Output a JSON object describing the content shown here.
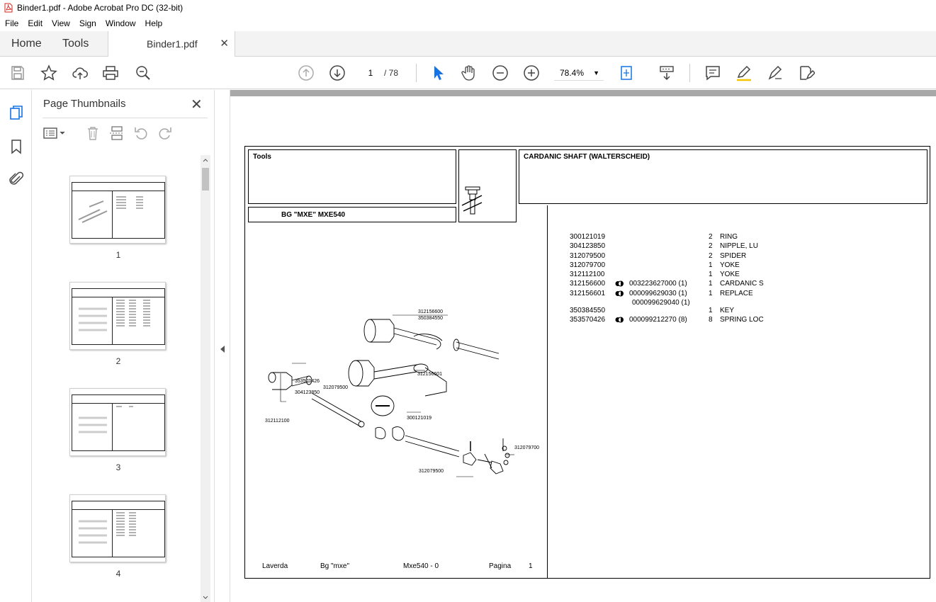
{
  "window": {
    "title": "Binder1.pdf - Adobe Acrobat Pro DC (32-bit)"
  },
  "menu": [
    "File",
    "Edit",
    "View",
    "Sign",
    "Window",
    "Help"
  ],
  "tabs": {
    "home": "Home",
    "tools": "Tools",
    "doc": "Binder1.pdf"
  },
  "toolbar": {
    "page_current": "1",
    "page_total": "/  78",
    "zoom": "78.4%"
  },
  "side_panel": {
    "title": "Page Thumbnails",
    "thumbnails": [
      "1",
      "2",
      "3",
      "4"
    ]
  },
  "document": {
    "tools_label": "Tools",
    "title": "CARDANIC SHAFT (WALTERSCHEID)",
    "model": "BG \"MXE\" MXE540",
    "parts": [
      {
        "code": "300121019",
        "ref": "",
        "qty": "2",
        "desc": "RING",
        "dot": false
      },
      {
        "code": "304123850",
        "ref": "",
        "qty": "2",
        "desc": "NIPPLE, LU",
        "dot": false
      },
      {
        "code": "312079500",
        "ref": "",
        "qty": "2",
        "desc": "SPIDER",
        "dot": false
      },
      {
        "code": "312079700",
        "ref": "",
        "qty": "1",
        "desc": "YOKE",
        "dot": false
      },
      {
        "code": "312112100",
        "ref": "",
        "qty": "1",
        "desc": "YOKE",
        "dot": false
      },
      {
        "code": "312156600",
        "ref": "003223627000  (1)",
        "qty": "1",
        "desc": "CARDANIC S",
        "dot": true
      },
      {
        "code": "312156601",
        "ref": "000099629030  (1)",
        "qty": "1",
        "desc": "REPLACE",
        "dot": true
      },
      {
        "code": "",
        "ref": "000099629040  (1)",
        "qty": "",
        "desc": "",
        "dot": false
      },
      {
        "code": "350384550",
        "ref": "",
        "qty": "1",
        "desc": "KEY",
        "dot": false
      },
      {
        "code": "353570426",
        "ref": "000099212270  (8)",
        "qty": "8",
        "desc": "SPRING LOC",
        "dot": true
      }
    ],
    "callouts": [
      "312156600",
      "350384550",
      "312156601",
      "353570426",
      "304123850",
      "312079500",
      "312112100",
      "300121019",
      "312079700",
      "312079500"
    ],
    "footer": {
      "brand": "Laverda",
      "model": "Bg \"mxe\"",
      "code": "Mxe540 - 0",
      "page_label": "Pagina",
      "page_num": "1"
    }
  }
}
